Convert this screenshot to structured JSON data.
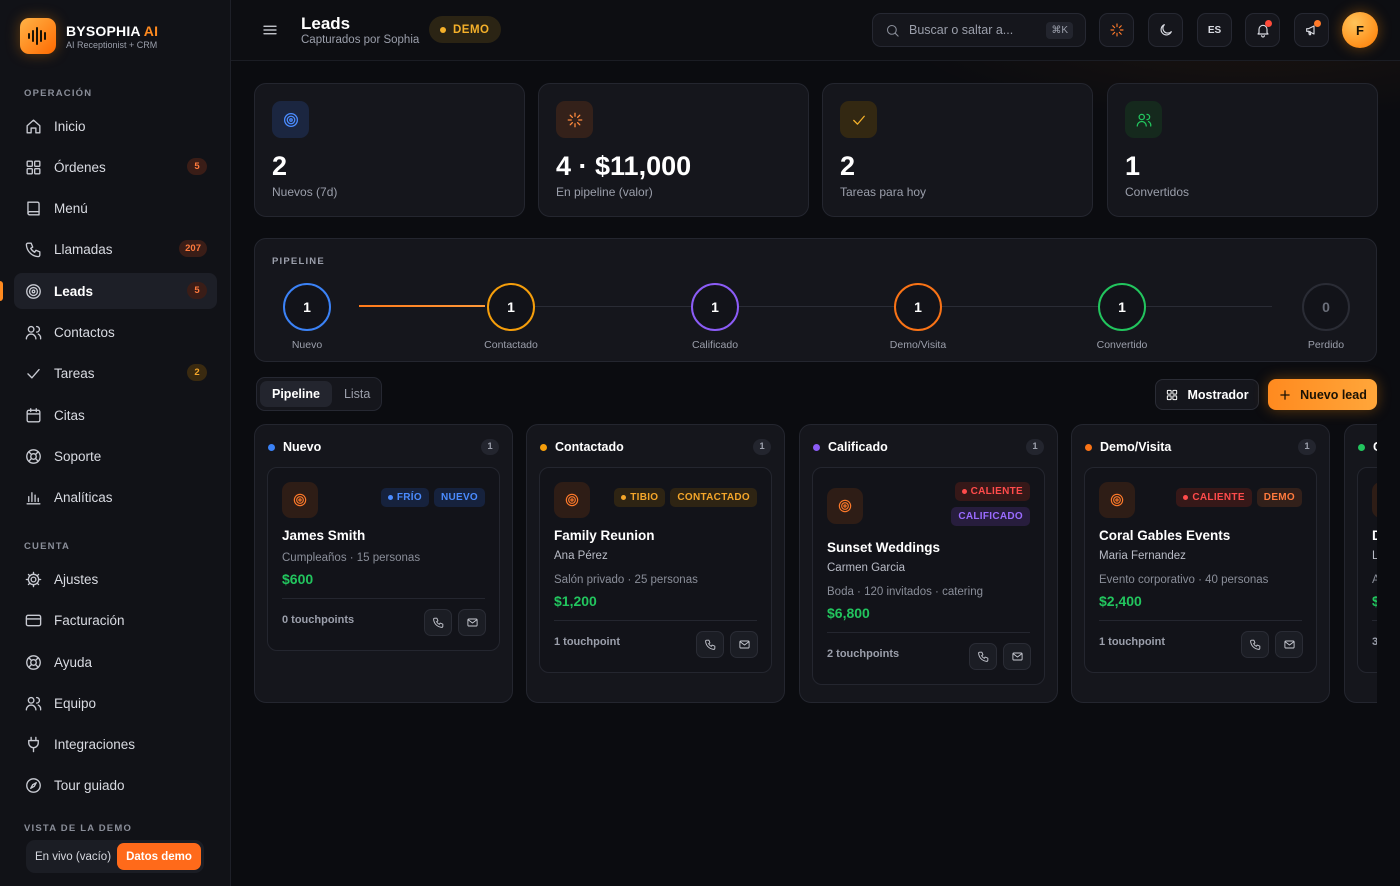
{
  "brand": {
    "name": "BYSOPHIA",
    "name_accent": "AI",
    "subtitle": "AI Receptionist + CRM"
  },
  "sidebar": {
    "section_operacion": "OPERACIÓN",
    "section_cuenta": "CUENTA",
    "section_demo": "VISTA DE LA DEMO",
    "items": [
      {
        "label": "Inicio",
        "icon": "home-icon"
      },
      {
        "label": "Órdenes",
        "icon": "grid-icon",
        "badge": "5"
      },
      {
        "label": "Menú",
        "icon": "book-icon"
      },
      {
        "label": "Llamadas",
        "icon": "phone-icon",
        "badge": "207"
      },
      {
        "label": "Leads",
        "icon": "target-icon",
        "badge": "5",
        "active": true
      },
      {
        "label": "Contactos",
        "icon": "users-icon"
      },
      {
        "label": "Tareas",
        "icon": "check-icon",
        "badge": "2"
      },
      {
        "label": "Citas",
        "icon": "calendar-icon"
      },
      {
        "label": "Soporte",
        "icon": "lifebuoy-icon"
      },
      {
        "label": "Analíticas",
        "icon": "bar-chart-icon"
      }
    ],
    "account_items": [
      {
        "label": "Ajustes",
        "icon": "gear-icon"
      },
      {
        "label": "Facturación",
        "icon": "credit-card-icon"
      },
      {
        "label": "Ayuda",
        "icon": "help-ring-icon"
      },
      {
        "label": "Equipo",
        "icon": "team-icon"
      },
      {
        "label": "Integraciones",
        "icon": "plug-icon"
      },
      {
        "label": "Tour guiado",
        "icon": "compass-icon"
      }
    ],
    "demo_toggle": {
      "off_label": "En vivo (vacío)",
      "on_label": "Datos demo"
    }
  },
  "header": {
    "title": "Leads",
    "subtitle": "Capturados por Sophia",
    "demo_badge": "DEMO",
    "search_placeholder": "Buscar o saltar a...",
    "search_shortcut": "⌘K",
    "lang": "ES",
    "avatar_initial": "F"
  },
  "stats": [
    {
      "value": "2",
      "label": "Nuevos (7d)",
      "icon": "target-icon",
      "color": "#4b8cff",
      "bg": "#1b2640"
    },
    {
      "value": "4 · $11,000",
      "label": "En pipeline (valor)",
      "icon": "spark-icon",
      "color": "#ff8a3d",
      "bg": "#34211a"
    },
    {
      "value": "2",
      "label": "Tareas para hoy",
      "icon": "check-icon",
      "color": "#f4b02a",
      "bg": "#332812"
    },
    {
      "value": "1",
      "label": "Convertidos",
      "icon": "users-icon",
      "color": "#22c55e",
      "bg": "#15291d"
    }
  ],
  "pipeline": {
    "title": "PIPELINE",
    "stages": [
      {
        "label": "Nuevo",
        "count": "1",
        "color": "#3b82f6"
      },
      {
        "label": "Contactado",
        "count": "1",
        "color": "#f59e0b"
      },
      {
        "label": "Calificado",
        "count": "1",
        "color": "#8b5cf6"
      },
      {
        "label": "Demo/Visita",
        "count": "1",
        "color": "#f97316"
      },
      {
        "label": "Convertido",
        "count": "1",
        "color": "#22c55e"
      },
      {
        "label": "Perdido",
        "count": "0",
        "color": "#2a2c35"
      }
    ]
  },
  "view": {
    "tab_pipeline": "Pipeline",
    "tab_lista": "Lista",
    "mostrador_label": "Mostrador",
    "new_lead_label": "Nuevo lead"
  },
  "columns": [
    {
      "name": "Nuevo",
      "count": "1",
      "color": "#3b82f6",
      "card": {
        "name": "James Smith",
        "contact": "",
        "desc": "Cumpleaños · 15 personas",
        "amount": "$600",
        "touchpoints": "0 touchpoints",
        "tags": [
          {
            "label": "FRÍO",
            "style": "t-blue",
            "dot": true
          },
          {
            "label": "NUEVO",
            "style": "t-blue",
            "dot": false
          }
        ]
      }
    },
    {
      "name": "Contactado",
      "count": "1",
      "color": "#f59e0b",
      "card": {
        "name": "Family Reunion",
        "contact": "Ana Pérez",
        "desc": "Salón privado · 25 personas",
        "amount": "$1,200",
        "touchpoints": "1 touchpoint",
        "tags": [
          {
            "label": "TIBIO",
            "style": "t-amber",
            "dot": true
          },
          {
            "label": "CONTACTADO",
            "style": "t-amber",
            "dot": false
          }
        ]
      }
    },
    {
      "name": "Calificado",
      "count": "1",
      "color": "#8b5cf6",
      "card": {
        "name": "Sunset Weddings",
        "contact": "Carmen Garcia",
        "desc": "Boda · 120 invitados · catering",
        "amount": "$6,800",
        "touchpoints": "2 touchpoints",
        "tags": [
          {
            "label": "CALIENTE",
            "style": "t-red",
            "dot": true
          },
          {
            "label": "CALIFICADO",
            "style": "t-purple",
            "dot": false
          }
        ]
      }
    },
    {
      "name": "Demo/Visita",
      "count": "1",
      "color": "#f97316",
      "card": {
        "name": "Coral Gables Events",
        "contact": "Maria Fernandez",
        "desc": "Evento corporativo · 40 personas",
        "amount": "$2,400",
        "touchpoints": "1 touchpoint",
        "tags": [
          {
            "label": "CALIENTE",
            "style": "t-red",
            "dot": true
          },
          {
            "label": "DEMO",
            "style": "t-orange",
            "dot": false
          }
        ]
      }
    },
    {
      "name": "C",
      "count": "",
      "color": "#22c55e",
      "card": {
        "name": "D",
        "contact": "L",
        "desc": "A",
        "amount": "$",
        "touchpoints": "3",
        "tags": []
      }
    }
  ]
}
